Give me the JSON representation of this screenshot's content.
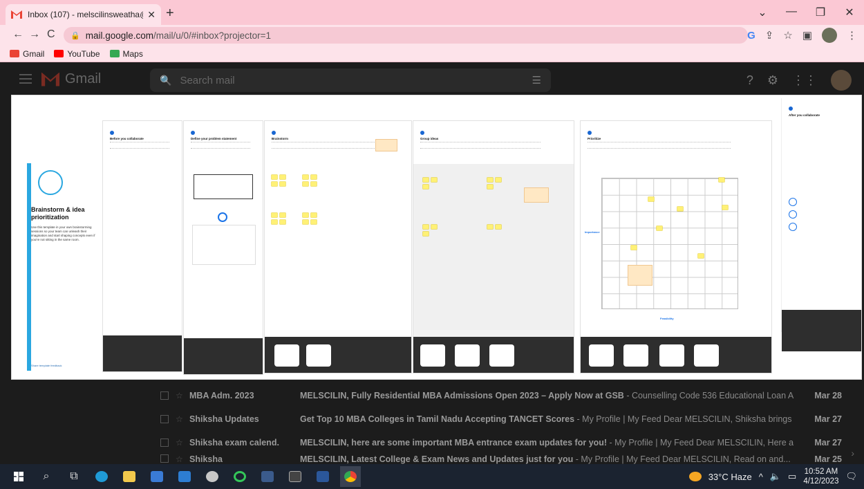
{
  "browser": {
    "tab_title": "Inbox (107) - melscilinsweatha@",
    "url_host": "mail.google.com",
    "url_path": "/mail/u/0/#inbox?projector=1",
    "bookmarks": [
      {
        "label": "Gmail",
        "color": "#ea4335"
      },
      {
        "label": "YouTube",
        "color": "#ff0000"
      },
      {
        "label": "Maps",
        "color": "#34a853"
      }
    ]
  },
  "gmail": {
    "product_name": "Gmail",
    "search_placeholder": "Search mail",
    "emails": [
      {
        "from": "MBA Adm. 2023",
        "subject": "MELSCILIN, Fully Residential MBA Admissions Open 2023 – Apply Now at GSB",
        "snippet": " - Counselling Code 536 Educational Loan A...",
        "date": "Mar 28"
      },
      {
        "from": "Shiksha Updates",
        "subject": "Get Top 10 MBA Colleges in Tamil Nadu Accepting TANCET Scores",
        "snippet": " - My Profile | My Feed Dear MELSCILIN, Shiksha brings c...",
        "date": "Mar 27"
      },
      {
        "from": "Shiksha exam calend.",
        "subject": "MELSCILIN, here are some important MBA entrance exam updates for you!",
        "snippet": " - My Profile | My Feed Dear MELSCILIN, Here ar...",
        "date": "Mar 27"
      },
      {
        "from": "Shiksha",
        "subject": "MELSCILIN, Latest College & Exam News and Updates just for you",
        "snippet": " - My Profile | My Feed Dear MELSCILIN, Read on and...",
        "date": "Mar 25"
      }
    ]
  },
  "projector": {
    "cover_title": "Brainstorm & idea prioritization",
    "cover_desc": "Use this template in your own brainstorming sessions so your team can unleash their imagination and start shaping concepts even if you're not sitting in the same room.",
    "cover_footer": "Share template feedback",
    "boards": [
      {
        "title": "Before you collaborate"
      },
      {
        "title": "Define your problem statement"
      },
      {
        "title": "Brainstorm"
      },
      {
        "title": "Group ideas"
      },
      {
        "title": "Prioritize"
      },
      {
        "title": "After you collaborate"
      }
    ],
    "axis_y": "Importance",
    "axis_x": "Feasibility"
  },
  "taskbar": {
    "weather": "33°C  Haze",
    "time": "10:52 AM",
    "date": "4/12/2023"
  }
}
